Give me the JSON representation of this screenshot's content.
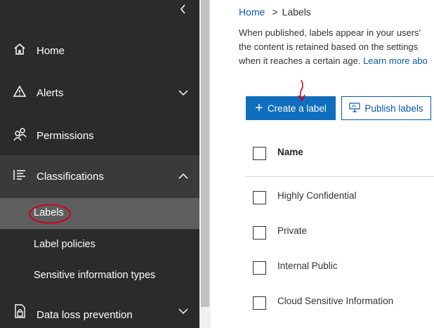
{
  "sidebar": {
    "items": [
      {
        "label": "Home",
        "icon": "home-icon"
      },
      {
        "label": "Alerts",
        "icon": "alert-icon"
      },
      {
        "label": "Permissions",
        "icon": "people-icon"
      },
      {
        "label": "Classifications",
        "icon": "list-icon"
      },
      {
        "label": "Data loss prevention",
        "icon": "lock-doc-icon"
      }
    ],
    "sub_items": [
      {
        "label": "Labels",
        "active": true
      },
      {
        "label": "Label policies"
      },
      {
        "label": "Sensitive information types"
      }
    ]
  },
  "breadcrumb": {
    "home": "Home",
    "separator": ">",
    "current": "Labels"
  },
  "description": {
    "line1": "When published, labels appear in your users'",
    "line2": "the content is retained based on the settings",
    "line3": "when it reaches a certain age.",
    "link": "Learn more abo"
  },
  "toolbar": {
    "create_label": "Create a label",
    "publish_labels": "Publish labels"
  },
  "table": {
    "header": "Name",
    "rows": [
      "Highly Confidential",
      "Private",
      "Internal Public",
      "Cloud Sensitive Information"
    ]
  },
  "colors": {
    "sidebar_bg": "#2b2b2b",
    "accent": "#106ebe",
    "annotation": "#d0021b"
  }
}
